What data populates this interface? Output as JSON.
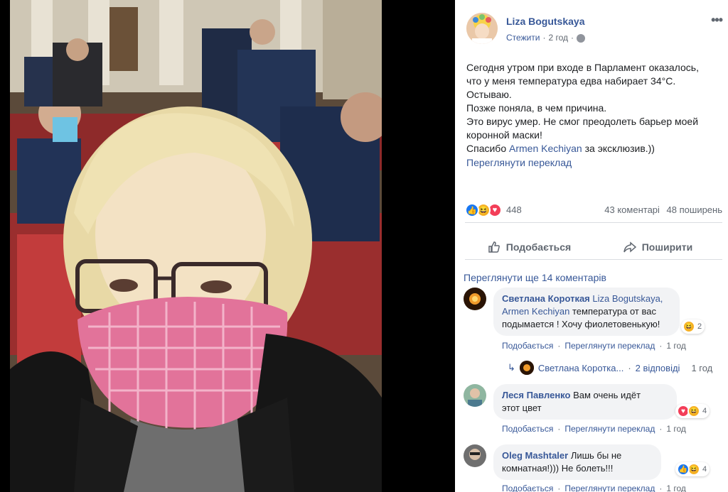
{
  "post": {
    "author": "Liza Bogutskaya",
    "follow": "Стежити",
    "time": "2 год",
    "more_icon": "more-dots-icon",
    "text_lines": [
      "Сегодня утром при входе в Парламент оказалось,",
      "что у меня температура едва набирает 34°С.",
      "Остываю.",
      "Позже поняла, в чем причина.",
      "Это вирус умер. Не смог преодолеть барьер моей",
      "коронной маски!"
    ],
    "thanks_prefix": "Спасибо ",
    "thanks_link": "Armen Kechiyan",
    "thanks_suffix": " за эксклюзив.))",
    "translate": "Переглянути переклад"
  },
  "reactions": {
    "count": "448",
    "comments": "43 коментарі",
    "shares": "48 поширень",
    "colors": {
      "like": "#1877f2",
      "haha": "#f7b125",
      "love": "#f33e58"
    }
  },
  "actions": {
    "like": "Подобається",
    "share": "Поширити"
  },
  "view_more": "Переглянути ще 14 коментарів",
  "comments": [
    {
      "name": "Светлана Короткая",
      "tag1": "Liza Bogutskaya,",
      "tag2": "Armen Kechiyan",
      "text1": " температура от вас",
      "text2": "подымается ! Хочу фиолетовенькую!",
      "reactions": "2",
      "like": "Подобається",
      "translate": "Переглянути переклад",
      "time": "1 год"
    },
    {
      "name": "Леся Павленко",
      "text1": " Вам очень идёт",
      "text2": "этот цвет",
      "reactions": "4",
      "like": "Подобається",
      "translate": "Переглянути переклад",
      "time": "1 год"
    },
    {
      "name": "Oleg Mashtaler",
      "text1": " Лишь бы не",
      "text2": "комнатная!))) Не болеть!!!",
      "reactions": "4",
      "like": "Подобається",
      "translate": "Переглянути переклад",
      "time": "1 год"
    }
  ],
  "replies": {
    "name": "Светлана Коротка...",
    "sep": "·",
    "count": "2 відповіді",
    "time": "1 год"
  }
}
